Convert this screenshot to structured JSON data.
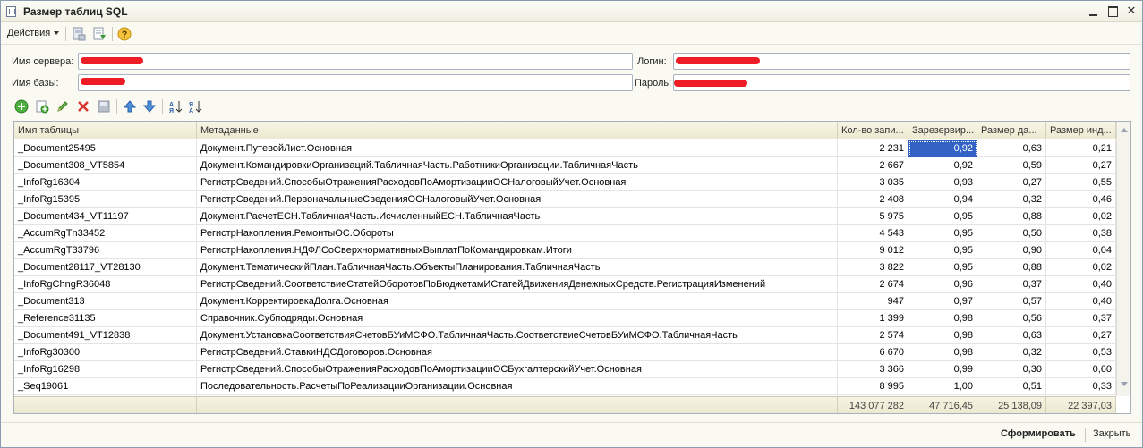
{
  "window": {
    "title": "Размер таблиц SQL"
  },
  "menubar": {
    "actions_label": "Действия"
  },
  "form": {
    "server_label": "Имя сервера:",
    "server_value": "",
    "db_label": "Имя базы:",
    "db_value": "",
    "login_label": "Логин:",
    "login_value": "",
    "password_label": "Пароль:",
    "password_value": ""
  },
  "table": {
    "columns": [
      "Имя таблицы",
      "Метаданные",
      "Кол-во запи...",
      "Зарезервир...",
      "Размер да...",
      "Размер инд..."
    ],
    "rows": [
      [
        "_Document25495",
        "Документ.ПутевойЛист.Основная",
        "2 231",
        "0,92",
        "0,63",
        "0,21"
      ],
      [
        "_Document308_VT5854",
        "Документ.КомандировкиОрганизаций.ТабличнаяЧасть.РаботникиОрганизации.ТабличнаяЧасть",
        "2 667",
        "0,92",
        "0,59",
        "0,27"
      ],
      [
        "_InfoRg16304",
        "РегистрСведений.СпособыОтраженияРасходовПоАмортизацииОСНалоговыйУчет.Основная",
        "3 035",
        "0,93",
        "0,27",
        "0,55"
      ],
      [
        "_InfoRg15395",
        "РегистрСведений.ПервоначальныеСведенияОСНалоговыйУчет.Основная",
        "2 408",
        "0,94",
        "0,32",
        "0,46"
      ],
      [
        "_Document434_VT11197",
        "Документ.РасчетЕСН.ТабличнаяЧасть.ИсчисленныйЕСН.ТабличнаяЧасть",
        "5 975",
        "0,95",
        "0,88",
        "0,02"
      ],
      [
        "_AccumRgTn33452",
        "РегистрНакопления.РемонтыОС.Обороты",
        "4 543",
        "0,95",
        "0,50",
        "0,38"
      ],
      [
        "_AccumRgT33796",
        "РегистрНакопления.НДФЛСоСверхнормативныхВыплатПоКомандировкам.Итоги",
        "9 012",
        "0,95",
        "0,90",
        "0,04"
      ],
      [
        "_Document28117_VT28130",
        "Документ.ТематическийПлан.ТабличнаяЧасть.ОбъектыПланирования.ТабличнаяЧасть",
        "3 822",
        "0,95",
        "0,88",
        "0,02"
      ],
      [
        "_InfoRgChngR36048",
        "РегистрСведений.СоответствиеСтатейОборотовПоБюджетамИСтатейДвиженияДенежныхСредств.РегистрацияИзменений",
        "2 674",
        "0,96",
        "0,37",
        "0,40"
      ],
      [
        "_Document313",
        "Документ.КорректировкаДолга.Основная",
        "947",
        "0,97",
        "0,57",
        "0,40"
      ],
      [
        "_Reference31135",
        "Справочник.Субподряды.Основная",
        "1 399",
        "0,98",
        "0,56",
        "0,37"
      ],
      [
        "_Document491_VT12838",
        "Документ.УстановкаСоответствияСчетовБУиМСФО.ТабличнаяЧасть.СоответствиеСчетовБУиМСФО.ТабличнаяЧасть",
        "2 574",
        "0,98",
        "0,63",
        "0,27"
      ],
      [
        "_InfoRg30300",
        "РегистрСведений.СтавкиНДСДоговоров.Основная",
        "6 670",
        "0,98",
        "0,32",
        "0,53"
      ],
      [
        "_InfoRg16298",
        "РегистрСведений.СпособыОтраженияРасходовПоАмортизацииОСБухгалтерскийУчет.Основная",
        "3 366",
        "0,99",
        "0,30",
        "0,60"
      ],
      [
        "_Seq19061",
        "Последовательность.РасчетыПоРеализацииОрганизации.Основная",
        "8 995",
        "1,00",
        "0,51",
        "0,33"
      ]
    ],
    "totals": [
      "",
      "",
      "143 077 282",
      "47 716,45",
      "25 138,09",
      "22 397,03"
    ]
  },
  "bottombar": {
    "generate_label": "Сформировать",
    "close_label": "Закрыть"
  },
  "colors": {
    "selection": "#3162c4",
    "redaction": "#ee1c24"
  }
}
